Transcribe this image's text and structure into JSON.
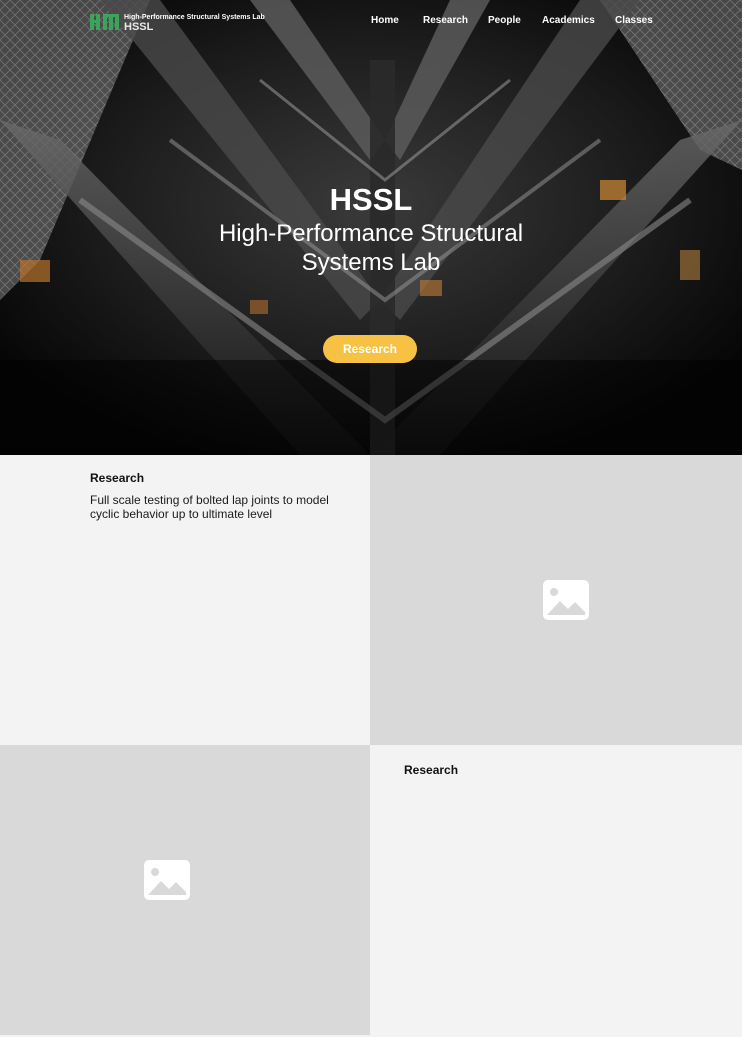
{
  "nav": {
    "logo_subtitle": "High-Performance Structural Systems Lab",
    "logo_title": "HSSL",
    "links": [
      "Home",
      "Research",
      "People",
      "Academics",
      "Classes"
    ]
  },
  "hero": {
    "title": "HSSL",
    "subtitle": "High-Performance Structural Systems Lab",
    "button_label": "Research"
  },
  "sections": [
    {
      "title": "Research",
      "description": "Full scale testing of bolted lap joints to model cyclic behavior up to ultimate level",
      "image_icon": "image-placeholder-icon"
    },
    {
      "title": "Research",
      "image_icon": "image-placeholder-icon"
    }
  ],
  "colors": {
    "accent": "#f7c244",
    "logo_green": "#3aa55a",
    "panel_light": "#f3f3f3",
    "panel_gray": "#d9d9d9"
  }
}
